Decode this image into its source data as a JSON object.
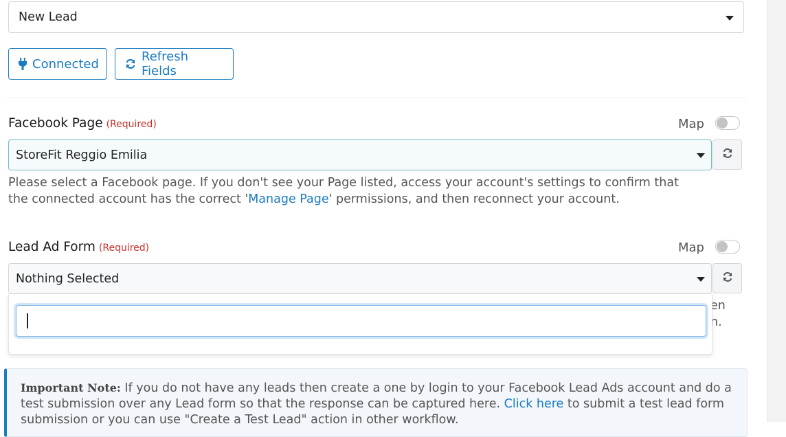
{
  "trigger_event": {
    "selected": "New Lead"
  },
  "buttons": {
    "connected": "Connected",
    "refresh_fields": "Refresh Fields"
  },
  "facebook_page": {
    "label": "Facebook Page",
    "required": "(Required)",
    "map_label": "Map",
    "selected": "StoreFit Reggio Emilia",
    "help_before": "Please select a Facebook page. If you don't see your Page listed, access your account's settings to confirm that the connected account has the correct '",
    "help_link": "Manage Page",
    "help_after": "' permissions, and then reconnect your account."
  },
  "lead_ad_form": {
    "label": "Lead Ad Form",
    "required": "(Required)",
    "map_label": "Map",
    "selected": "Nothing Selected",
    "search_value": "",
    "peek_line1": "en",
    "peek_line2": "n."
  },
  "note": {
    "title": "Important Note:",
    "text_before": " If you do not have any leads then create a one by login to your Facebook Lead Ads account and do a test submission over any Lead form so that the response can be captured here. ",
    "link": "Click here",
    "text_after": " to submit a test lead form submission or you can use \"Create a Test Lead\" action in other workflow."
  },
  "colors": {
    "accent": "#1a7bbf",
    "required": "#c9302c"
  },
  "icons": {
    "connected": "plug-icon",
    "refresh": "refresh-icon",
    "dropdown": "chevron-down-icon"
  }
}
